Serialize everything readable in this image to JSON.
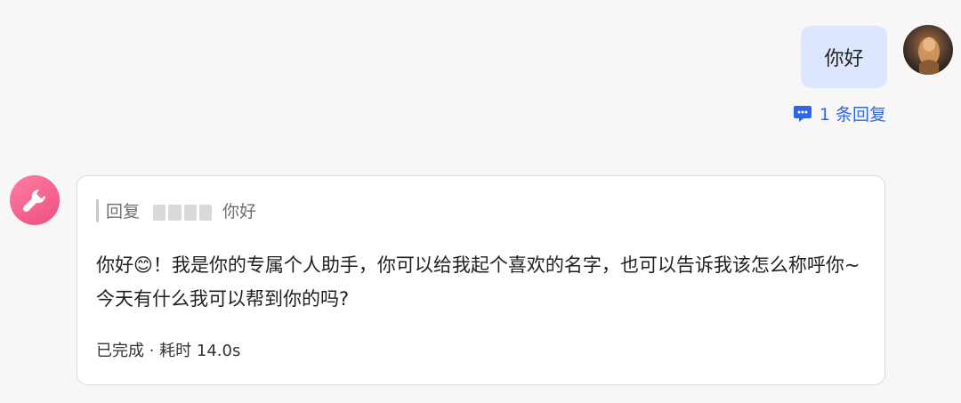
{
  "user_message": {
    "text": "你好",
    "avatar": "user-avatar-image",
    "reply_count": "1 条回复",
    "reply_icon": "comment-icon"
  },
  "bot_message": {
    "avatar": "wrench-icon",
    "quote": {
      "label": "回复",
      "name_hidden": true,
      "text": "你好"
    },
    "reply_text": "你好😊！我是你的专属个人助手，你可以给我起个喜欢的名字，也可以告诉我该怎么称呼你~ 今天有什么我可以帮到你的吗?",
    "status": "已完成 · 耗时 14.0s"
  },
  "colors": {
    "user_bubble": "#dce6fd",
    "link": "#3065e8",
    "bot_avatar": "#ec4f7e",
    "background": "#f7f7f8"
  }
}
